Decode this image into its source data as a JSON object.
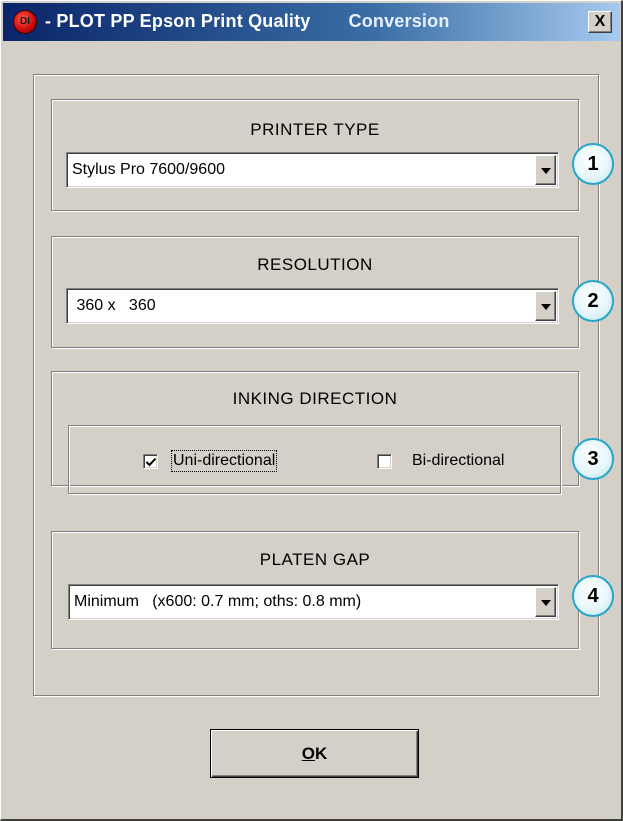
{
  "window": {
    "logo_text": "DI",
    "title": "- PLOT  PP Epson  Print Quality",
    "title_suffix": "Conversion",
    "close_label": "X"
  },
  "printer_type": {
    "label": "PRINTER TYPE",
    "selected": "Stylus Pro 7600/9600",
    "callout": "1"
  },
  "resolution": {
    "label": "RESOLUTION",
    "selected": " 360 x   360",
    "callout": "2"
  },
  "inking_direction": {
    "label": "INKING DIRECTION",
    "options": [
      {
        "label": "Uni-directional",
        "checked": true
      },
      {
        "label": "Bi-directional",
        "checked": false
      }
    ],
    "callout": "3"
  },
  "platen_gap": {
    "label": "PLATEN GAP",
    "selected": "Minimum   (x600: 0.7 mm; oths: 0.8 mm)",
    "callout": "4"
  },
  "ok_button": {
    "mnemonic": "O",
    "rest": "K"
  },
  "colors": {
    "title_gradient_start": "#0a246a",
    "title_gradient_end": "#a6caf0",
    "dialog_face": "#d4d0c8",
    "callout_border": "#27a6c7"
  }
}
